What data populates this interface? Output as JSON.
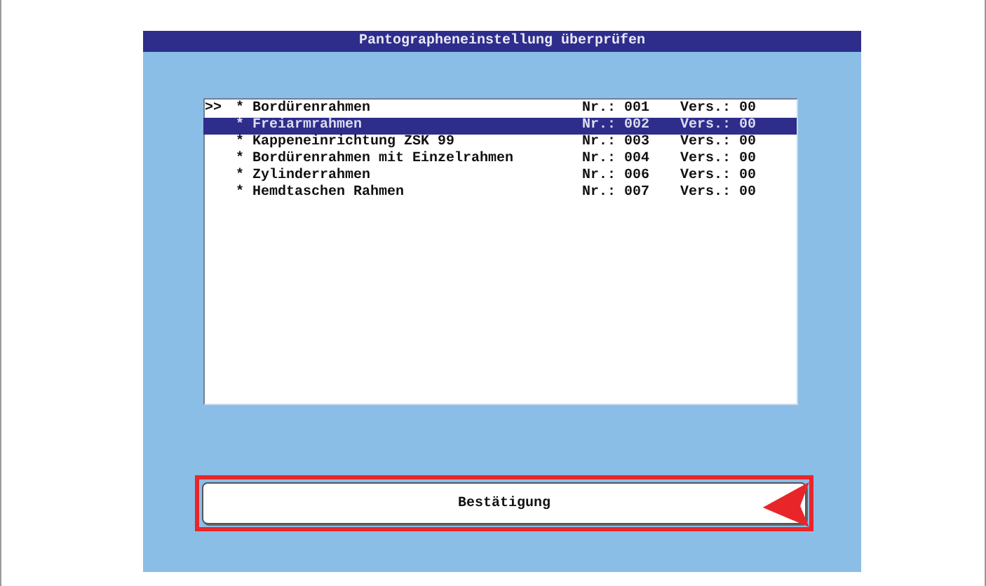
{
  "window": {
    "title": "Pantographeneinstellung überprüfen"
  },
  "list": {
    "rows": [
      {
        "marker": ">>",
        "name": "* Bordürenrahmen",
        "number": "Nr.: 001",
        "version": "Vers.: 00",
        "selected": false
      },
      {
        "name": "* Freiarmrahmen",
        "number": "Nr.: 002",
        "version": "Vers.: 00",
        "selected": true
      },
      {
        "name": "* Kappeneinrichtung ZSK 99",
        "number": "Nr.: 003",
        "version": "Vers.: 00",
        "selected": false
      },
      {
        "name": "* Bordürenrahmen mit Einzelrahmen",
        "number": "Nr.: 004",
        "version": "Vers.: 00",
        "selected": false
      },
      {
        "name": "* Zylinderrahmen",
        "number": "Nr.: 006",
        "version": "Vers.: 00",
        "selected": false
      },
      {
        "name": "* Hemdtaschen Rahmen",
        "number": "Nr.: 007",
        "version": "Vers.: 00",
        "selected": false
      }
    ]
  },
  "confirm_button": {
    "label": "Bestätigung",
    "highlighted": true
  }
}
